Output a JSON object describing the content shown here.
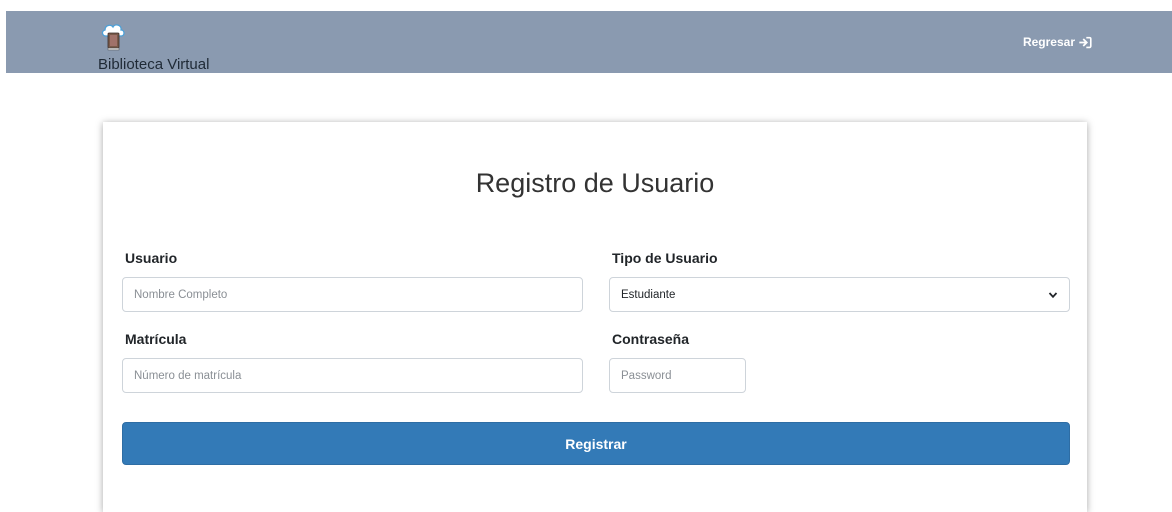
{
  "header": {
    "brand_text": "Biblioteca Virtual",
    "logo_icon": "cloud-book-icon",
    "back_link_label": "Regresar",
    "back_link_icon": "sign-in-icon",
    "background_color": "#8a9ab0"
  },
  "form": {
    "title": "Registro de Usuario",
    "usuario": {
      "label": "Usuario",
      "placeholder": "Nombre Completo",
      "value": ""
    },
    "tipo_usuario": {
      "label": "Tipo de Usuario",
      "selected": "Estudiante"
    },
    "matricula": {
      "label": "Matrícula",
      "placeholder": "Número de matrícula",
      "value": ""
    },
    "contrasena": {
      "label": "Contraseña",
      "placeholder": "Password",
      "value": ""
    },
    "submit_label": "Registrar",
    "submit_color": "#337ab7"
  }
}
